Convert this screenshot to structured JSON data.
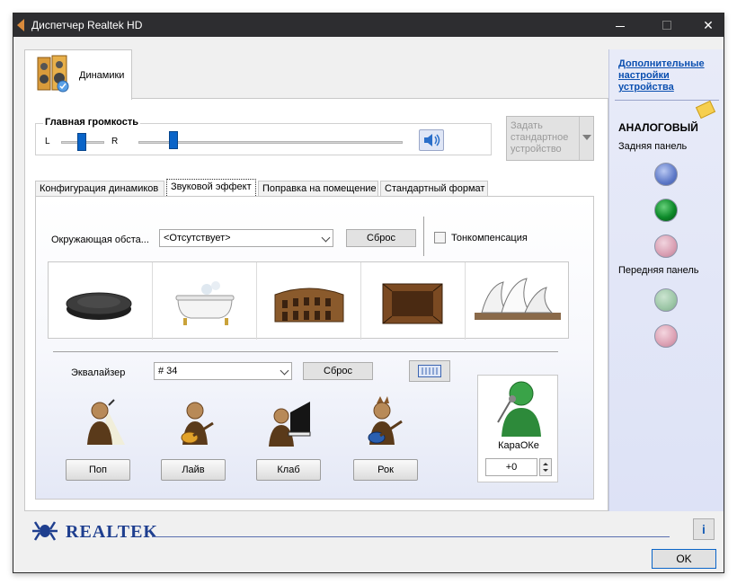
{
  "window": {
    "title": "Диспетчер Realtek HD"
  },
  "device_tab": {
    "label": "Динамики"
  },
  "right_panel": {
    "advanced_link": "Дополнительные настройки устройства",
    "analog_title": "АНАЛОГОВЫЙ",
    "rear_panel": "Задняя панель",
    "front_panel": "Передняя панель"
  },
  "volume": {
    "title": "Главная громкость",
    "left": "L",
    "right": "R",
    "balance_level": 0.5,
    "master_level": 0.12
  },
  "default_device_button": "Задать стандартное устройство",
  "tabs": [
    {
      "label": "Конфигурация динамиков"
    },
    {
      "label": "Звуковой эффект"
    },
    {
      "label": "Поправка на помещение"
    },
    {
      "label": "Стандартный формат"
    }
  ],
  "active_tab": 1,
  "environment": {
    "label": "Окружающая обста...",
    "selected": "<Отсутствует>",
    "reset": "Сброс",
    "loudness_label": "Тонкомпенсация",
    "loudness_checked": false
  },
  "equalizer": {
    "label": "Эквалайзер",
    "selected": "# 34",
    "reset": "Сброс",
    "presets": [
      "Поп",
      "Лайв",
      "Клаб",
      "Рок"
    ]
  },
  "karaoke": {
    "label": "КараОКе",
    "value": "+0"
  },
  "brand": "REALTEK",
  "info_icon": "i",
  "ok_button": "OK",
  "colors": {
    "titlebar": "#2d2d30",
    "accent": "#0a64c8",
    "link": "#0b4fb0",
    "brand": "#1f3f8f"
  }
}
